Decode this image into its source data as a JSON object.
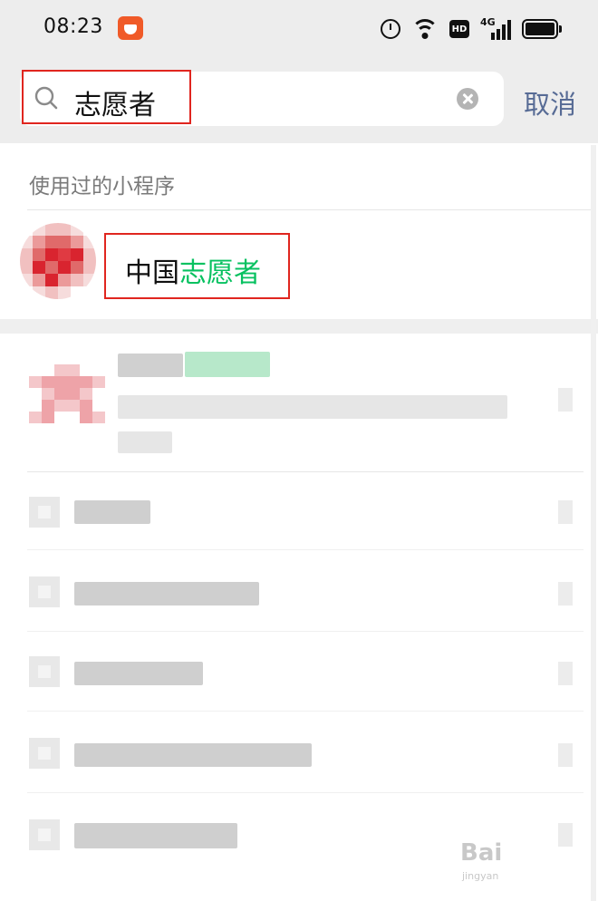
{
  "status_bar": {
    "time": "08:23",
    "hd_label": "HD",
    "network_label": "4G"
  },
  "search": {
    "query": "志愿者",
    "cancel_label": "取消"
  },
  "section": {
    "title": "使用过的小程序"
  },
  "mini_program": {
    "name_prefix": "中国",
    "name_highlight": "志愿者"
  },
  "colors": {
    "accent_green": "#07c160",
    "cancel_blue": "#576b95",
    "annotation_red": "#e0261f"
  },
  "icons": [
    "search-icon",
    "clear-icon",
    "alarm-icon",
    "wifi-icon",
    "signal-icon",
    "battery-icon"
  ]
}
